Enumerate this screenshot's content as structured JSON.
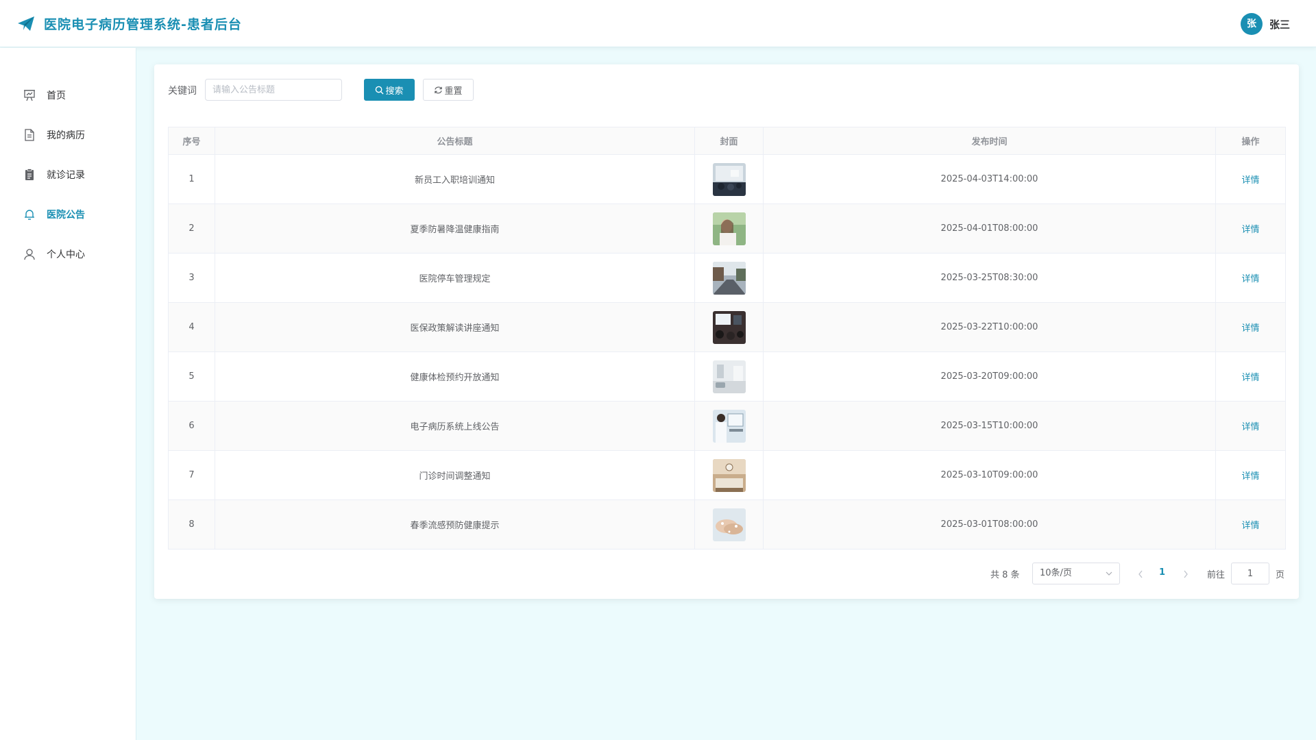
{
  "header": {
    "app_title": "医院电子病历管理系统-患者后台",
    "avatar_text": "张",
    "username": "张三"
  },
  "sidebar": {
    "items": [
      {
        "label": "首页",
        "icon": "presentation-chart-icon",
        "active": false
      },
      {
        "label": "我的病历",
        "icon": "document-icon",
        "active": false
      },
      {
        "label": "就诊记录",
        "icon": "clipboard-icon",
        "active": false
      },
      {
        "label": "医院公告",
        "icon": "bell-icon",
        "active": true
      },
      {
        "label": "个人中心",
        "icon": "user-icon",
        "active": false
      }
    ]
  },
  "search": {
    "keyword_label": "关键词",
    "placeholder": "请输入公告标题",
    "value": "",
    "search_label": "搜索",
    "reset_label": "重置"
  },
  "table": {
    "headers": [
      "序号",
      "公告标题",
      "封面",
      "发布时间",
      "操作"
    ],
    "rows": [
      {
        "index": "1",
        "title": "新员工入职培训通知",
        "cover": "training-room-photo",
        "time": "2025-04-03T14:00:00",
        "action": "详情"
      },
      {
        "index": "2",
        "title": "夏季防暑降温健康指南",
        "cover": "summer-drink-photo",
        "time": "2025-04-01T08:00:00",
        "action": "详情"
      },
      {
        "index": "3",
        "title": "医院停车管理规定",
        "cover": "parking-lot-photo",
        "time": "2025-03-25T08:30:00",
        "action": "详情"
      },
      {
        "index": "4",
        "title": "医保政策解读讲座通知",
        "cover": "lecture-photo",
        "time": "2025-03-22T10:00:00",
        "action": "详情"
      },
      {
        "index": "5",
        "title": "健康体检预约开放通知",
        "cover": "clinic-hall-photo",
        "time": "2025-03-20T09:00:00",
        "action": "详情"
      },
      {
        "index": "6",
        "title": "电子病历系统上线公告",
        "cover": "doctor-computer-photo",
        "time": "2025-03-15T10:00:00",
        "action": "详情"
      },
      {
        "index": "7",
        "title": "门诊时间调整通知",
        "cover": "reception-desk-photo",
        "time": "2025-03-10T09:00:00",
        "action": "详情"
      },
      {
        "index": "8",
        "title": "春季流感预防健康提示",
        "cover": "hand-washing-photo",
        "time": "2025-03-01T08:00:00",
        "action": "详情"
      }
    ]
  },
  "pagination": {
    "total_text": "共 8 条",
    "page_size": "10条/页",
    "current_page": "1",
    "goto_label": "前往",
    "goto_value": "1",
    "page_unit": "页"
  },
  "colors": {
    "accent": "#1a8fb3",
    "background": "#ecfbfd"
  }
}
